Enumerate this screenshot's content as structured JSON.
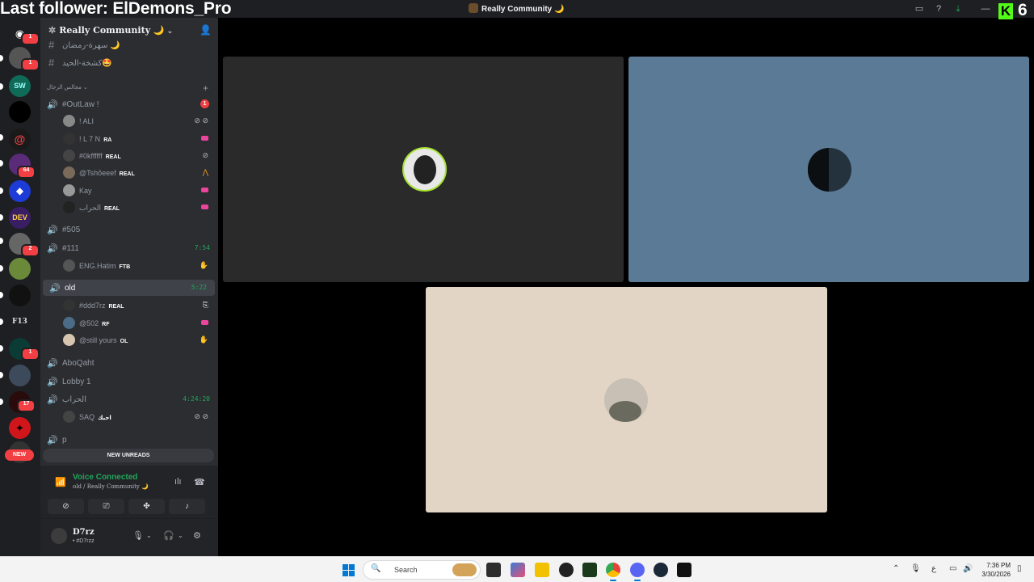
{
  "overlay": {
    "follower_text": "Last follower: ElDemons_Pro",
    "kick_count": "6",
    "kick_letter": "K"
  },
  "window": {
    "title": "Really Community 🌙"
  },
  "rail": {
    "badges": [
      "1",
      "1",
      "64",
      "2",
      "1",
      "17"
    ],
    "server_labels": [
      "SW",
      "DEV",
      "F13"
    ],
    "new_label": "NEW"
  },
  "server": {
    "name": "Really Community 🌙"
  },
  "channels": {
    "text": [
      {
        "name": "سهرة-رمضان 🌙"
      },
      {
        "name": "كشخة-الحيد🤩"
      }
    ],
    "category": "مجالس الرجال"
  },
  "voice": [
    {
      "name": "#OutLaw !",
      "badge": "1",
      "users": [
        {
          "name": "! ALI",
          "tag": ""
        },
        {
          "name": "! L 7 N",
          "tag": "RA"
        },
        {
          "name": "#0kffffff",
          "tag": "REAL"
        },
        {
          "name": "@Tshōeeef",
          "tag": "REAL"
        },
        {
          "name": "Kay",
          "tag": ""
        },
        {
          "name": "الحراب",
          "tag": "REAL"
        }
      ]
    },
    {
      "name": "#505"
    },
    {
      "name": "#111",
      "timer": "7:54",
      "users": [
        {
          "name": "ENG.Hatim",
          "tag": "FTB"
        }
      ]
    },
    {
      "name": "old",
      "timer": "5:22",
      "users": [
        {
          "name": "#ddd7rz",
          "tag": "REAL"
        },
        {
          "name": "@502",
          "tag": "RF"
        },
        {
          "name": "@still yours",
          "tag": "OL"
        }
      ]
    },
    {
      "name": "AboQaht"
    },
    {
      "name": "Lobby 1"
    },
    {
      "name": "الحراب",
      "timer": "4:24:20",
      "users": [
        {
          "name": "SAQ",
          "tag": "احبك"
        }
      ]
    },
    {
      "name": "p"
    }
  ],
  "new_unreads": "NEW UNREADS",
  "voice_panel": {
    "title": "Voice Connected",
    "subtitle": "old / Really Community 🌙"
  },
  "user_panel": {
    "name": "D7rz",
    "sub": "• #D7rzz"
  },
  "stage_colors": {
    "tile1": "#2a2a2a",
    "tile2": "#5b7a96",
    "tile3": "#e2d5c6"
  },
  "taskbar": {
    "search_placeholder": "Search",
    "time": "7:36 PM",
    "date": "3/30/2026",
    "lang": "ع"
  }
}
